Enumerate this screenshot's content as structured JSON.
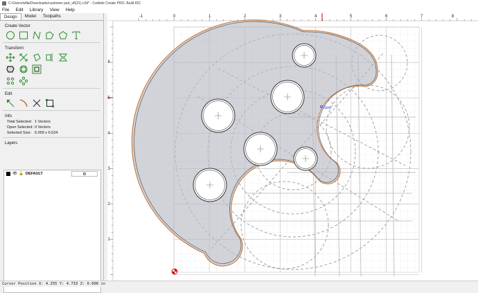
{
  "window": {
    "title": "C:/Users/willa/Downloads/customer part_v8(21).c2d* - Carbide Create PRO, Build 821"
  },
  "menu": [
    "File",
    "Edit",
    "Library",
    "View",
    "Help"
  ],
  "tabs": [
    {
      "label": "Design",
      "active": true
    },
    {
      "label": "Model",
      "active": false
    },
    {
      "label": "Toolpaths",
      "active": false
    }
  ],
  "sections": {
    "create_vector": "Create Vector",
    "transform": "Transform",
    "edit": "Edit",
    "info": "Info",
    "layers": "Layers"
  },
  "info": {
    "total_label": "Total Selected:",
    "total_value": "1 Vectors",
    "open_label": "Open Selected:",
    "open_value": "0 Vectors",
    "size_label": "Selected Size:",
    "size_value": "6.009 x 6.524"
  },
  "layers": [
    {
      "name": "DEFAULT",
      "color": "#000000"
    }
  ],
  "ruler": {
    "labels": [
      "-1",
      "0",
      "1",
      "2",
      "3",
      "4",
      "5",
      "6",
      "7",
      "8"
    ],
    "vlabels": [
      "6",
      "5",
      "4",
      "3",
      "2",
      "1"
    ]
  },
  "canvas": {
    "grid_label": "Grid"
  },
  "status": {
    "cursor": "Cursor Position X: 4.255 Y: 4.733 Z: 0.000 in"
  },
  "colors": {
    "selection": "#d08040",
    "guide": "#3a3a3a",
    "ruler_marker": "#cc0000",
    "part_fill": "#b9bcc4"
  }
}
